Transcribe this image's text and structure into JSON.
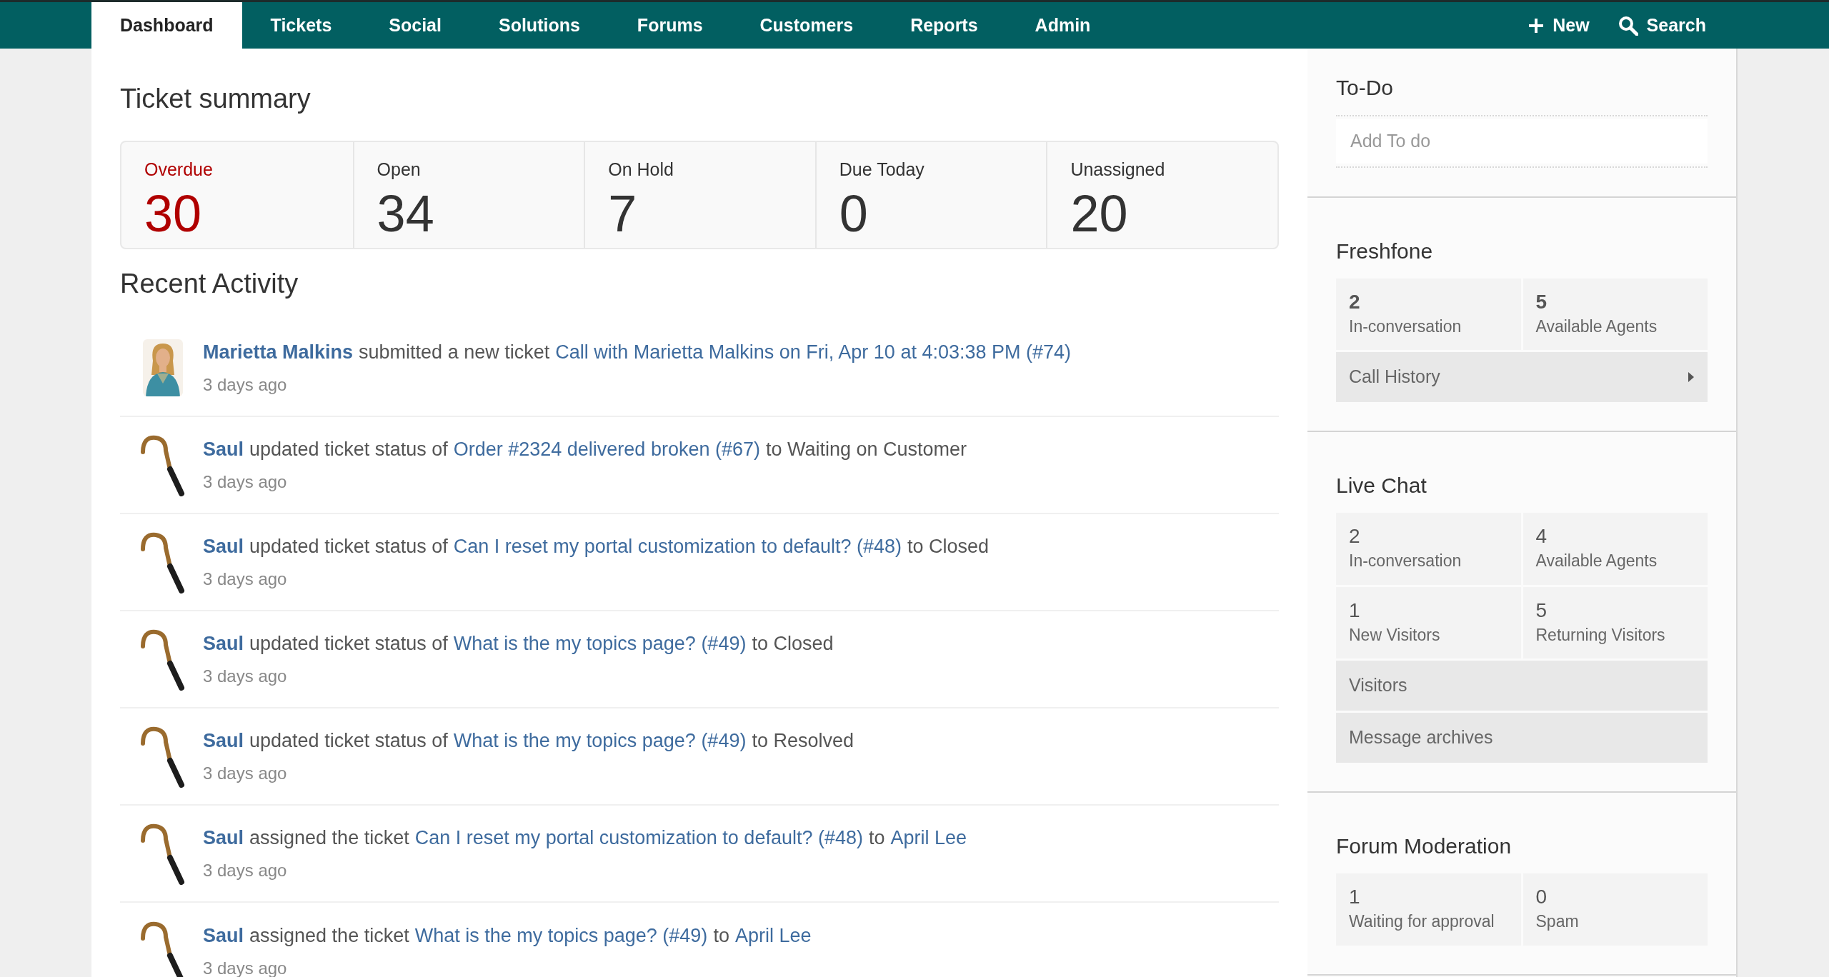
{
  "nav": {
    "tabs": [
      {
        "label": "Dashboard",
        "selected": true
      },
      {
        "label": "Tickets",
        "selected": false
      },
      {
        "label": "Social",
        "selected": false
      },
      {
        "label": "Solutions",
        "selected": false
      },
      {
        "label": "Forums",
        "selected": false
      },
      {
        "label": "Customers",
        "selected": false
      },
      {
        "label": "Reports",
        "selected": false
      },
      {
        "label": "Admin",
        "selected": false
      }
    ],
    "new_label": "New",
    "search_label": "Search"
  },
  "ticket_summary": {
    "title": "Ticket summary",
    "cards": [
      {
        "label": "Overdue",
        "count": "30",
        "alert": true
      },
      {
        "label": "Open",
        "count": "34",
        "alert": false
      },
      {
        "label": "On Hold",
        "count": "7",
        "alert": false
      },
      {
        "label": "Due Today",
        "count": "0",
        "alert": false
      },
      {
        "label": "Unassigned",
        "count": "20",
        "alert": false
      }
    ]
  },
  "recent_activity": {
    "title": "Recent Activity",
    "items": [
      {
        "avatar": {
          "kind": "picture"
        },
        "time": "3 days ago",
        "parts": [
          {
            "kind": "actor",
            "text": "Marietta Malkins"
          },
          {
            "kind": "text",
            "text": "submitted a new ticket"
          },
          {
            "kind": "link",
            "text": "Call with Marietta Malkins on Fri, Apr 10 at 4:03:38 PM (#74)"
          }
        ]
      },
      {
        "avatar": {
          "kind": "picture"
        },
        "time": "3 days ago",
        "parts": [
          {
            "kind": "actor",
            "text": "Saul"
          },
          {
            "kind": "text",
            "text": "updated ticket status of"
          },
          {
            "kind": "link",
            "text": "Order #2324 delivered broken (#67)"
          },
          {
            "kind": "text",
            "text": "to Waiting on Customer"
          }
        ]
      },
      {
        "avatar": {
          "kind": "picture"
        },
        "time": "3 days ago",
        "parts": [
          {
            "kind": "actor",
            "text": "Saul"
          },
          {
            "kind": "text",
            "text": "updated ticket status of"
          },
          {
            "kind": "link",
            "text": "Can I reset my portal customization to default? (#48)"
          },
          {
            "kind": "text",
            "text": "to Closed"
          }
        ]
      },
      {
        "avatar": {
          "kind": "picture"
        },
        "time": "3 days ago",
        "parts": [
          {
            "kind": "actor",
            "text": "Saul"
          },
          {
            "kind": "text",
            "text": "updated ticket status of"
          },
          {
            "kind": "link",
            "text": "What is the my topics page? (#49)"
          },
          {
            "kind": "text",
            "text": "to Closed"
          }
        ]
      },
      {
        "avatar": {
          "kind": "picture"
        },
        "time": "3 days ago",
        "parts": [
          {
            "kind": "actor",
            "text": "Saul"
          },
          {
            "kind": "text",
            "text": "updated ticket status of"
          },
          {
            "kind": "link",
            "text": "What is the my topics page? (#49)"
          },
          {
            "kind": "text",
            "text": "to Resolved"
          }
        ]
      },
      {
        "avatar": {
          "kind": "picture"
        },
        "time": "3 days ago",
        "parts": [
          {
            "kind": "actor",
            "text": "Saul"
          },
          {
            "kind": "text",
            "text": "assigned the ticket"
          },
          {
            "kind": "link",
            "text": "Can I reset my portal customization to default? (#48)"
          },
          {
            "kind": "text",
            "text": "to"
          },
          {
            "kind": "link",
            "text": "April Lee"
          }
        ]
      },
      {
        "avatar": {
          "kind": "picture"
        },
        "time": "3 days ago",
        "parts": [
          {
            "kind": "actor",
            "text": "Saul"
          },
          {
            "kind": "text",
            "text": "assigned the ticket"
          },
          {
            "kind": "link",
            "text": "What is the my topics page? (#49)"
          },
          {
            "kind": "text",
            "text": "to"
          },
          {
            "kind": "link",
            "text": "April Lee"
          }
        ]
      }
    ]
  },
  "sidebar": [
    {
      "kind": "todo",
      "title": "To-Do",
      "placeholder": "Add To do"
    },
    {
      "kind": "stats",
      "title": "Freshfone",
      "bold_numbers": true,
      "stats": [
        {
          "count": "2",
          "label": "In-conversation"
        },
        {
          "count": "5",
          "label": "Available Agents"
        }
      ],
      "links": [
        {
          "label": "Call History",
          "arrow": true
        }
      ]
    },
    {
      "kind": "stats",
      "title": "Live Chat",
      "bold_numbers": false,
      "stats": [
        {
          "count": "2",
          "label": "In-conversation"
        },
        {
          "count": "4",
          "label": "Available Agents"
        },
        {
          "count": "1",
          "label": "New Visitors"
        },
        {
          "count": "5",
          "label": "Returning Visitors"
        }
      ],
      "links": [
        {
          "label": "Visitors",
          "arrow": false
        },
        {
          "label": "Message archives",
          "arrow": false
        }
      ]
    },
    {
      "kind": "stats",
      "title": "Forum Moderation",
      "bold_numbers": false,
      "stats": [
        {
          "count": "1",
          "label": "Waiting for approval"
        },
        {
          "count": "0",
          "label": "Spam"
        }
      ]
    }
  ]
}
